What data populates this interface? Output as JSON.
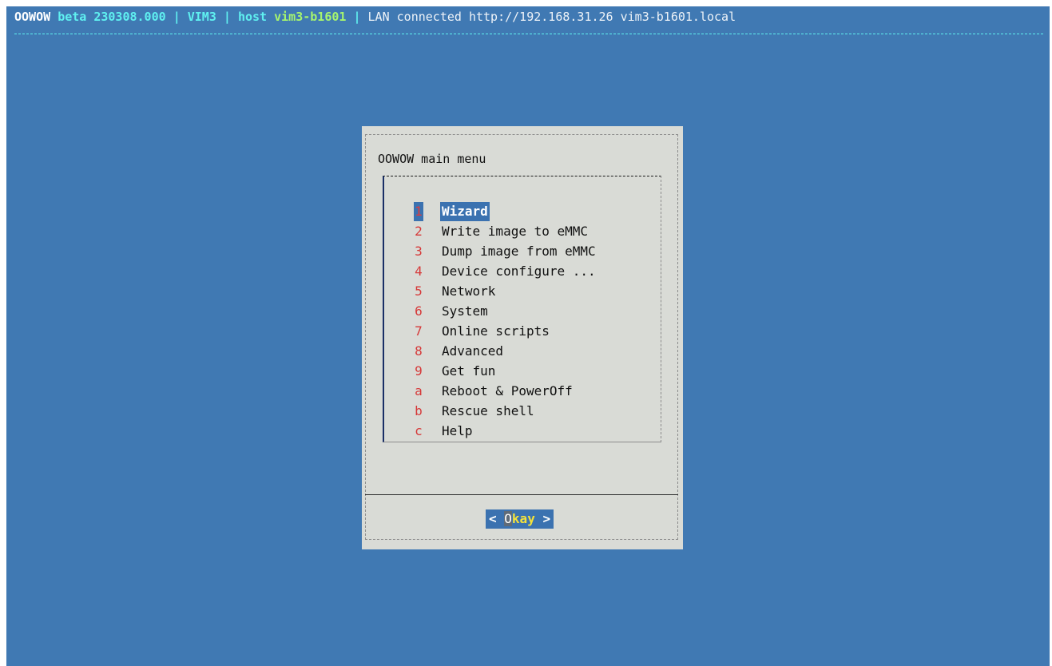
{
  "topbar": {
    "app": "OOWOW",
    "version": "beta 230308.000",
    "sep1": "|",
    "board": "VIM3",
    "sep2": "|",
    "host_label": "host",
    "host_name": "vim3-b1601",
    "sep3": "|",
    "status": "LAN connected http://192.168.31.26 vim3-b1601.local"
  },
  "dialog": {
    "title": "OOWOW main menu",
    "items": [
      {
        "key": "1",
        "label": "Wizard"
      },
      {
        "key": "2",
        "label": "Write image to eMMC"
      },
      {
        "key": "3",
        "label": "Dump image from eMMC"
      },
      {
        "key": "4",
        "label": "Device configure ..."
      },
      {
        "key": "5",
        "label": "Network"
      },
      {
        "key": "6",
        "label": "System"
      },
      {
        "key": "7",
        "label": "Online scripts"
      },
      {
        "key": "8",
        "label": "Advanced"
      },
      {
        "key": "9",
        "label": "Get fun"
      },
      {
        "key": "a",
        "label": "Reboot & PowerOff"
      },
      {
        "key": "b",
        "label": "Rescue shell"
      },
      {
        "key": "c",
        "label": "Help"
      }
    ],
    "selected_index": 0,
    "ok_button": {
      "left": "<",
      "hot": "O",
      "rest": "kay",
      "right": ">"
    }
  },
  "colors": {
    "background": "#4079b3",
    "dialog": "#d9dbd6",
    "highlight": "#3b72b0",
    "hotkey": "#d63a3a"
  }
}
